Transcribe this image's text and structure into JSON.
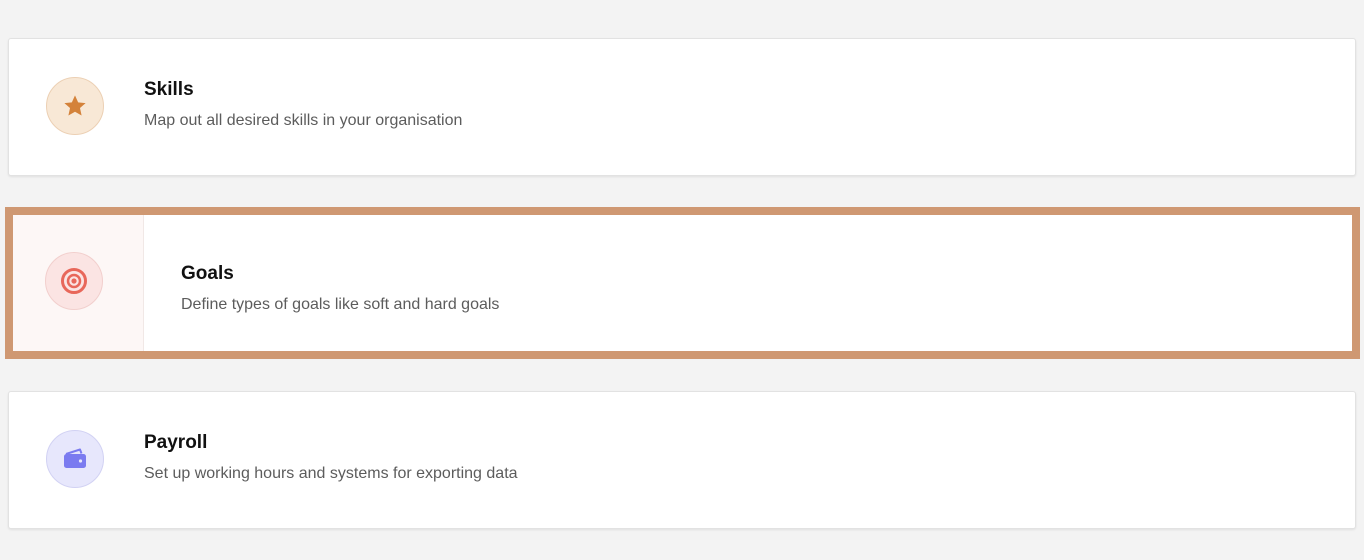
{
  "cards": [
    {
      "title": "Skills",
      "description": "Map out all desired skills in your organisation",
      "icon": "star-icon",
      "accent": "#d4823a"
    },
    {
      "title": "Goals",
      "description": "Define types of goals like soft and hard goals",
      "icon": "target-icon",
      "accent": "#e8675a",
      "highlighted": true,
      "highlight_color": "#cf9872"
    },
    {
      "title": "Payroll",
      "description": "Set up working hours and systems for exporting data",
      "icon": "wallet-icon",
      "accent": "#7b7bf0"
    }
  ]
}
